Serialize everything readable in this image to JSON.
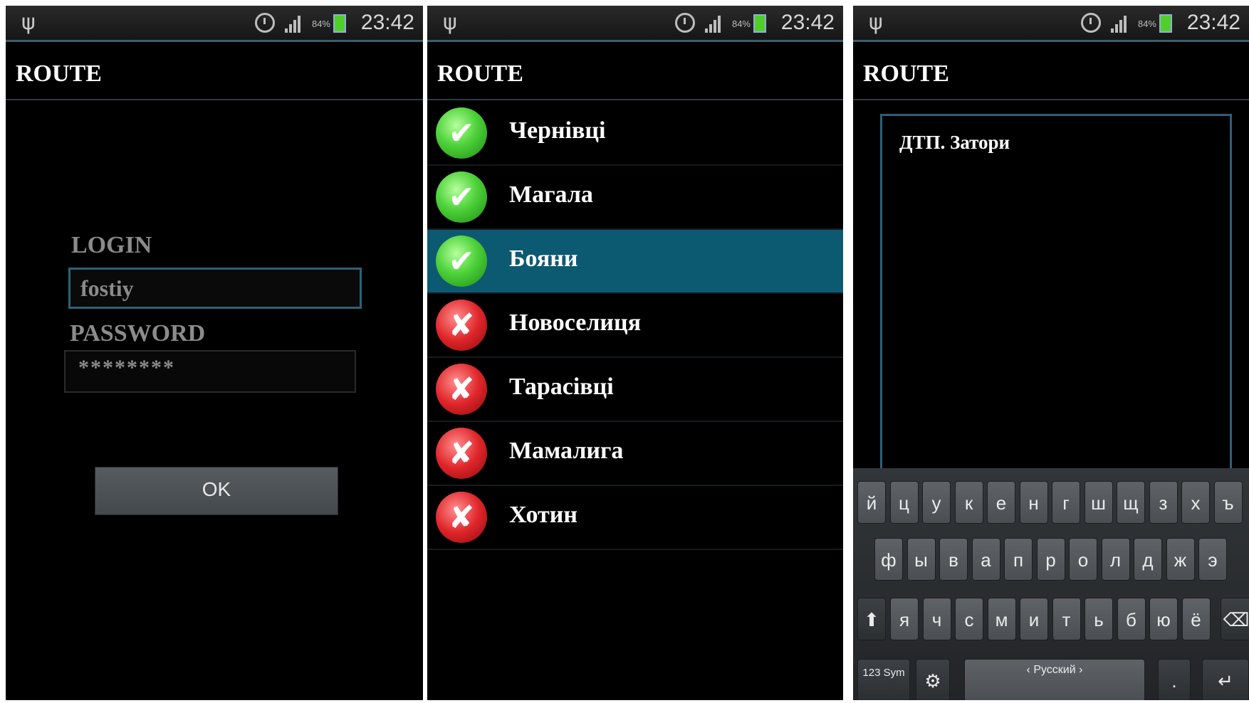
{
  "status": {
    "battery": "84%",
    "time": "23:42"
  },
  "app": {
    "title": "ROUTE"
  },
  "login_screen": {
    "login_label": "LOGIN",
    "login_value": "fostiy",
    "password_label": "PASSWORD",
    "password_value": "********",
    "ok_label": "OK"
  },
  "route_screen": {
    "items": [
      {
        "name": "Чернівці",
        "status": "ok"
      },
      {
        "name": "Магала",
        "status": "ok"
      },
      {
        "name": "Бояни",
        "status": "ok",
        "selected": true
      },
      {
        "name": "Новоселиця",
        "status": "fail"
      },
      {
        "name": "Тарасівці",
        "status": "fail"
      },
      {
        "name": "Мамалига",
        "status": "fail"
      },
      {
        "name": "Хотин",
        "status": "fail"
      }
    ]
  },
  "notes_screen": {
    "text": "ДТП. Затори",
    "keyboard": {
      "row1": [
        "й",
        "ц",
        "у",
        "к",
        "е",
        "н",
        "г",
        "ш",
        "щ",
        "з",
        "х",
        "ъ"
      ],
      "row2": [
        "ф",
        "ы",
        "в",
        "а",
        "п",
        "р",
        "о",
        "л",
        "д",
        "ж",
        "э"
      ],
      "row3": [
        "я",
        "ч",
        "с",
        "м",
        "и",
        "т",
        "ь",
        "б",
        "ю",
        "ё"
      ],
      "sym_label": "123 Sym",
      "space_label": "Русский",
      "period": "."
    }
  },
  "colors": {
    "accent": "#0c5a72",
    "ok": "#4ed23a",
    "fail": "#e0262a"
  }
}
